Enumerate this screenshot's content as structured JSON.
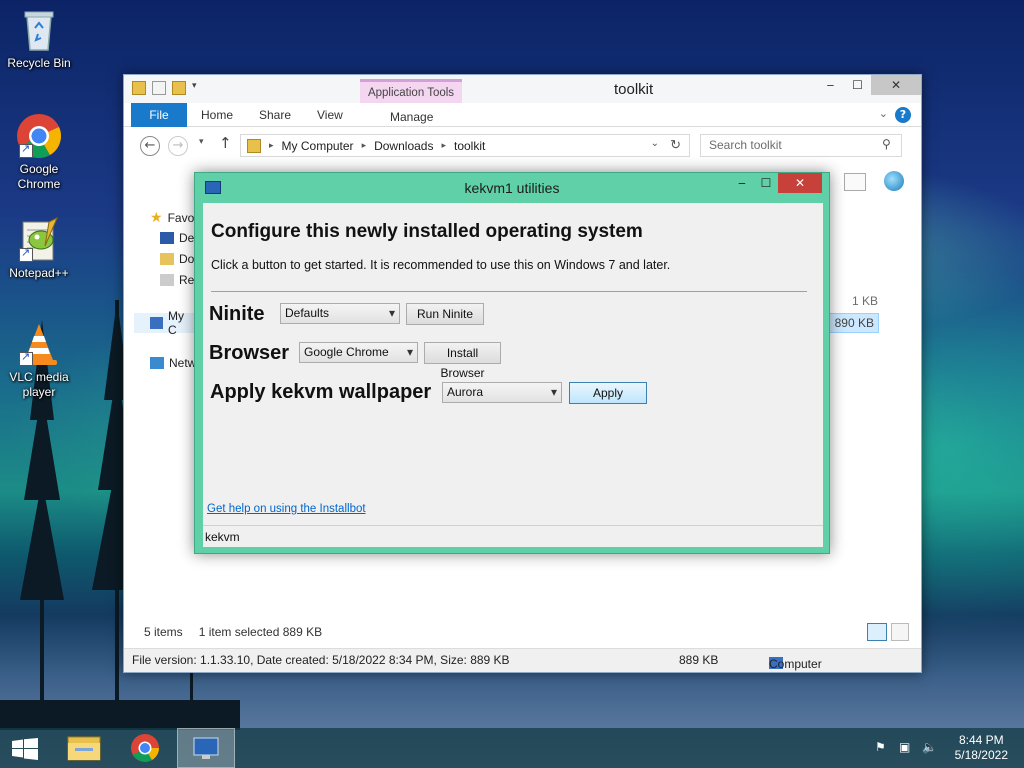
{
  "desktop": {
    "icons": [
      {
        "label": "Recycle Bin",
        "icon": "recycle-bin-icon"
      },
      {
        "label": "Google Chrome",
        "icon": "chrome-icon"
      },
      {
        "label": "Notepad++",
        "icon": "notepad-plus-plus-icon"
      },
      {
        "label": "VLC media player",
        "icon": "vlc-icon"
      }
    ]
  },
  "explorer": {
    "title": "toolkit",
    "context_tab_group": "Application Tools",
    "tabs": {
      "file": "File",
      "home": "Home",
      "share": "Share",
      "view": "View",
      "manage": "Manage"
    },
    "breadcrumb": [
      "My Computer",
      "Downloads",
      "toolkit"
    ],
    "search_placeholder": "Search toolkit",
    "nav": {
      "favorites": "Favo",
      "desktop": "De",
      "documents": "Do",
      "recent": "Re",
      "my_computer": "My C",
      "network": "Netw"
    },
    "file_sizes": [
      "1 KB",
      "890 KB"
    ],
    "status": {
      "items": "5 items",
      "selected": "1 item selected",
      "selected_size": "889 KB"
    },
    "details_bar": {
      "info": "File version: 1.1.33.10, Date created: 5/18/2022 8:34 PM, Size: 889 KB",
      "size": "889 KB",
      "location": "Computer"
    }
  },
  "dialog": {
    "title": "kekvm1 utilities",
    "heading": "Configure this newly installed operating system",
    "subtitle": "Click a button to get started. It is recommended to use this on Windows 7 and later.",
    "ninite": {
      "label": "Ninite",
      "selected": "Defaults",
      "button": "Run Ninite"
    },
    "browser": {
      "label": "Browser",
      "selected": "Google Chrome",
      "button": "Install Browser"
    },
    "wallpaper": {
      "label": "Apply kekvm wallpaper",
      "selected": "Aurora",
      "button": "Apply"
    },
    "help_link": "Get help on using the Installbot",
    "status": "kekvm"
  },
  "taskbar": {
    "time": "8:44 PM",
    "date": "5/18/2022"
  },
  "colors": {
    "dialog_frame": "#5fd0a8",
    "file_tab": "#1979ca",
    "close_button": "#c7413a",
    "link": "#0066cc"
  }
}
